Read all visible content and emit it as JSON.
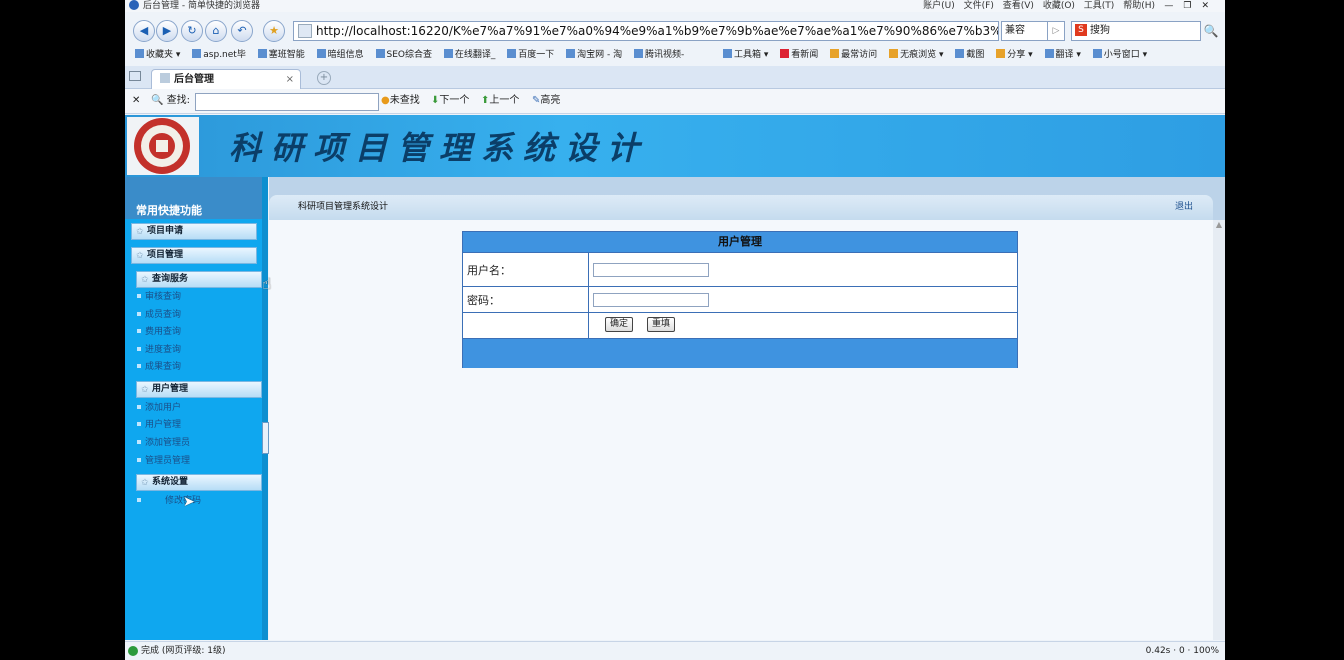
{
  "browser": {
    "title": "后台管理 - 简单快捷的浏览器",
    "menus": [
      "账户(U)",
      "文件(F)",
      "查看(V)",
      "收藏(O)",
      "工具(T)",
      "帮助(H)"
    ],
    "address": "http://localhost:16220/K%e7%a7%91%e7%a0%94%e9%a1%b9%e7%9b%ae%e7%ae%a1%e7%90%86%e7%b3%bb%e7%bl",
    "compat_label": "兼容",
    "search_placeholder": "搜狗",
    "favorites": [
      "收藏夹",
      "asp.net毕",
      "塞班智能",
      "暗组信息",
      "SEO综合查",
      "在线翻译_",
      "百度一下",
      "淘宝网 - 淘",
      "腾讯视频-"
    ],
    "favorites_right": [
      "工具箱",
      "看新闻",
      "最常访问",
      "无痕浏览",
      "截图",
      "分享",
      "翻译",
      "小号窗口"
    ],
    "tab_title": "后台管理",
    "find": {
      "label": "查找:",
      "value": "",
      "not_found": "未查找",
      "next": "下一个",
      "prev": "上一个",
      "highlight": "高亮"
    },
    "status": {
      "left": "完成 (网页评级: 1级)",
      "right": "0.42s · 0 · 100%"
    }
  },
  "app": {
    "banner_title": "科研项目管理系统设计",
    "sidebar": {
      "heading": "常用快捷功能",
      "top_buttons": [
        "项目申请",
        "项目管理"
      ],
      "groups": [
        {
          "label": "查询服务",
          "items": [
            "审核查询",
            "成员查询",
            "费用查询",
            "进度查询",
            "成果查询"
          ]
        },
        {
          "label": "用户管理",
          "items": [
            "添加用户",
            "用户管理",
            "添加管理员",
            "管理员管理"
          ]
        },
        {
          "label": "系统设置",
          "items": [
            "修改密码"
          ]
        }
      ]
    },
    "breadcrumb": "科研项目管理系统设计",
    "logout": "退出",
    "form": {
      "title": "用户管理",
      "username_label": "用户名：",
      "username_value": "",
      "password_label": "密码：",
      "password_value": "",
      "confirm": "确定",
      "reset": "重填"
    }
  }
}
